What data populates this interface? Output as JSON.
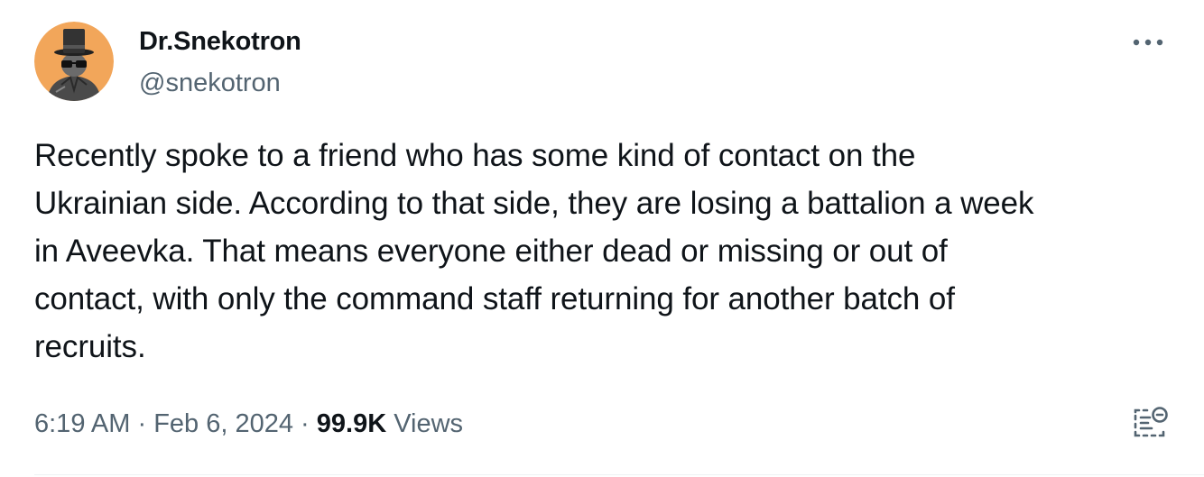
{
  "author": {
    "display_name": "Dr.Snekotron",
    "handle": "@snekotron",
    "avatar_icon": "cartoon-figure-top-hat-avatar",
    "avatar_bg": "#f2a65a"
  },
  "tweet": {
    "text": "Recently spoke to a friend who has some kind of contact on the\nUkrainian side. According to that side, they are losing a battalion a week\nin Aveevka. That means everyone either dead or missing or out of\ncontact, with only the command staff returning for another batch of\nrecruits."
  },
  "meta": {
    "time": "6:19 AM",
    "separator": "·",
    "date": "Feb 6, 2024",
    "views_count": "99.9K",
    "views_label": "Views"
  },
  "icons": {
    "more": "more-horizontal-icon",
    "analytics": "post-analytics-icon"
  },
  "colors": {
    "text_primary": "#0f1419",
    "text_secondary": "#536471",
    "background": "#ffffff"
  }
}
